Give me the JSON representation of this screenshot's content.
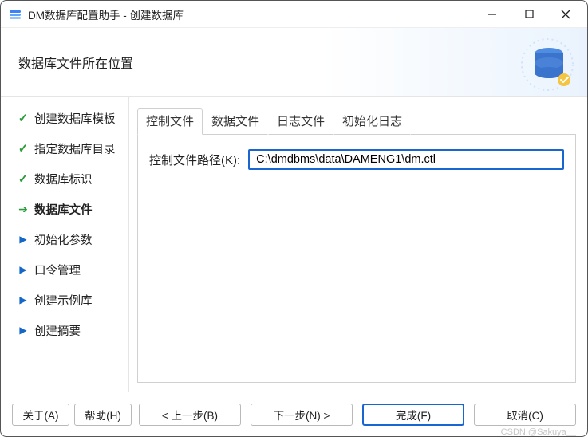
{
  "window": {
    "title": "DM数据库配置助手 - 创建数据库"
  },
  "header": {
    "heading": "数据库文件所在位置"
  },
  "sidebar": {
    "items": [
      {
        "label": "创建数据库模板",
        "state": "done"
      },
      {
        "label": "指定数据库目录",
        "state": "done"
      },
      {
        "label": "数据库标识",
        "state": "done"
      },
      {
        "label": "数据库文件",
        "state": "current"
      },
      {
        "label": "初始化参数",
        "state": "pending"
      },
      {
        "label": "口令管理",
        "state": "pending"
      },
      {
        "label": "创建示例库",
        "state": "pending"
      },
      {
        "label": "创建摘要",
        "state": "pending"
      }
    ]
  },
  "tabs": [
    {
      "label": "控制文件",
      "active": true
    },
    {
      "label": "数据文件",
      "active": false
    },
    {
      "label": "日志文件",
      "active": false
    },
    {
      "label": "初始化日志",
      "active": false
    }
  ],
  "panel": {
    "control_file_path_label": "控制文件路径(K):",
    "control_file_path_value": "C:\\dmdbms\\data\\DAMENG1\\dm.ctl"
  },
  "footer": {
    "about": "关于(A)",
    "help": "帮助(H)",
    "back": "< 上一步(B)",
    "next": "下一步(N) >",
    "finish": "完成(F)",
    "cancel": "取消(C)"
  },
  "watermark": "CSDN @Sakuya__"
}
